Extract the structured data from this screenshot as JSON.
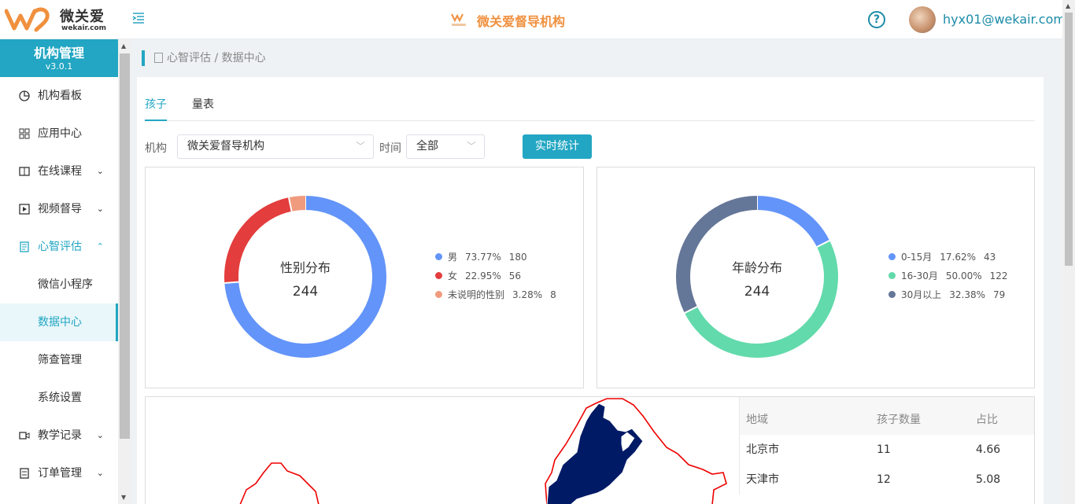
{
  "header": {
    "brand": "微关爱",
    "brand_domain": "wekair.com",
    "org_title": "微关爱督导机构",
    "mini_logo_text": "微关爱",
    "help_symbol": "?",
    "user": "hyx01@wekair.com"
  },
  "sidebar": {
    "title": "机构管理",
    "version": "v3.0.1",
    "items": [
      {
        "label": "机构看板",
        "icon": "pie-chart-icon"
      },
      {
        "label": "应用中心",
        "icon": "grid-icon"
      },
      {
        "label": "在线课程",
        "icon": "book-icon",
        "arrow": "⌄"
      },
      {
        "label": "视频督导",
        "icon": "play-icon",
        "arrow": "⌄"
      },
      {
        "label": "心智评估",
        "icon": "document-icon",
        "arrow": "⌃"
      },
      {
        "label": "微信小程序"
      },
      {
        "label": "数据中心"
      },
      {
        "label": "筛查管理"
      },
      {
        "label": "系统设置"
      },
      {
        "label": "教学记录",
        "icon": "video-icon",
        "arrow": "⌄"
      },
      {
        "label": "订单管理",
        "icon": "order-icon",
        "arrow": "⌄"
      }
    ]
  },
  "breadcrumb": "心智评估 / 数据中心",
  "tabs": [
    "孩子",
    "量表"
  ],
  "filters": {
    "org_label": "机构",
    "org_value": "微关爱督导机构",
    "time_label": "时间",
    "time_value": "全部",
    "button": "实时统计"
  },
  "chart_data": [
    {
      "type": "pie",
      "title": "性别分布",
      "total": "244",
      "series": [
        {
          "name": "男",
          "pct": "73.77%",
          "value": 180,
          "color": "#6394f9"
        },
        {
          "name": "女",
          "pct": "22.95%",
          "value": 56,
          "color": "#e33d3d"
        },
        {
          "name": "未说明的性别",
          "pct": "3.28%",
          "value": 8,
          "color": "#f19b7e"
        }
      ]
    },
    {
      "type": "pie",
      "title": "年龄分布",
      "total": "244",
      "series": [
        {
          "name": "0-15月",
          "pct": "17.62%",
          "value": 43,
          "color": "#6394f9"
        },
        {
          "name": "16-30月",
          "pct": "50.00%",
          "value": 122,
          "color": "#62daab"
        },
        {
          "name": "30月以上",
          "pct": "32.38%",
          "value": 79,
          "color": "#657798"
        }
      ]
    }
  ],
  "region_table": {
    "headers": [
      "地域",
      "孩子数量",
      "占比"
    ],
    "rows": [
      [
        "北京市",
        "11",
        "4.66"
      ],
      [
        "天津市",
        "12",
        "5.08"
      ]
    ]
  }
}
